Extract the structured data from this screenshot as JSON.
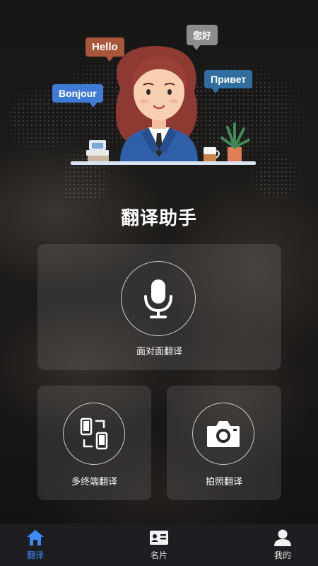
{
  "header": {
    "greetings": {
      "hello": "Hello",
      "nihao": "您好",
      "bonjour": "Bonjour",
      "privet": "Привет"
    },
    "app_title": "翻译助手"
  },
  "features": {
    "face_to_face": {
      "label": "面对面翻译",
      "icon": "microphone-icon"
    },
    "multi_device": {
      "label": "多终端翻译",
      "icon": "multi-device-icon"
    },
    "photo": {
      "label": "拍照翻译",
      "icon": "camera-icon"
    }
  },
  "tabbar": {
    "active_color": "#3d8bff",
    "items": [
      {
        "label": "翻译",
        "icon": "home-icon",
        "active": true
      },
      {
        "label": "名片",
        "icon": "business-card-icon",
        "active": false
      },
      {
        "label": "我的",
        "icon": "user-icon",
        "active": false
      }
    ]
  }
}
